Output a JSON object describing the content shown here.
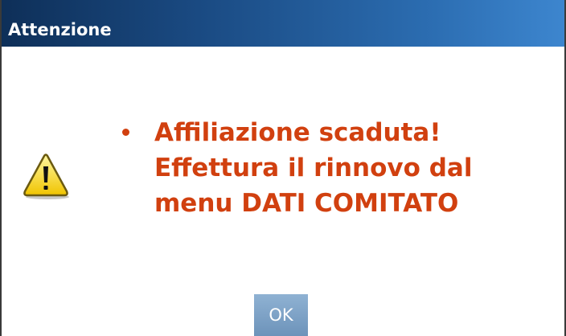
{
  "dialog": {
    "title": "Attenzione",
    "icon": "warning-icon",
    "message_color": "#d1400f",
    "message_lines": [
      "Affiliazione scaduta!",
      "Effettura il rinnovo dal",
      "menu DATI COMITATO"
    ],
    "ok_label": "OK"
  }
}
